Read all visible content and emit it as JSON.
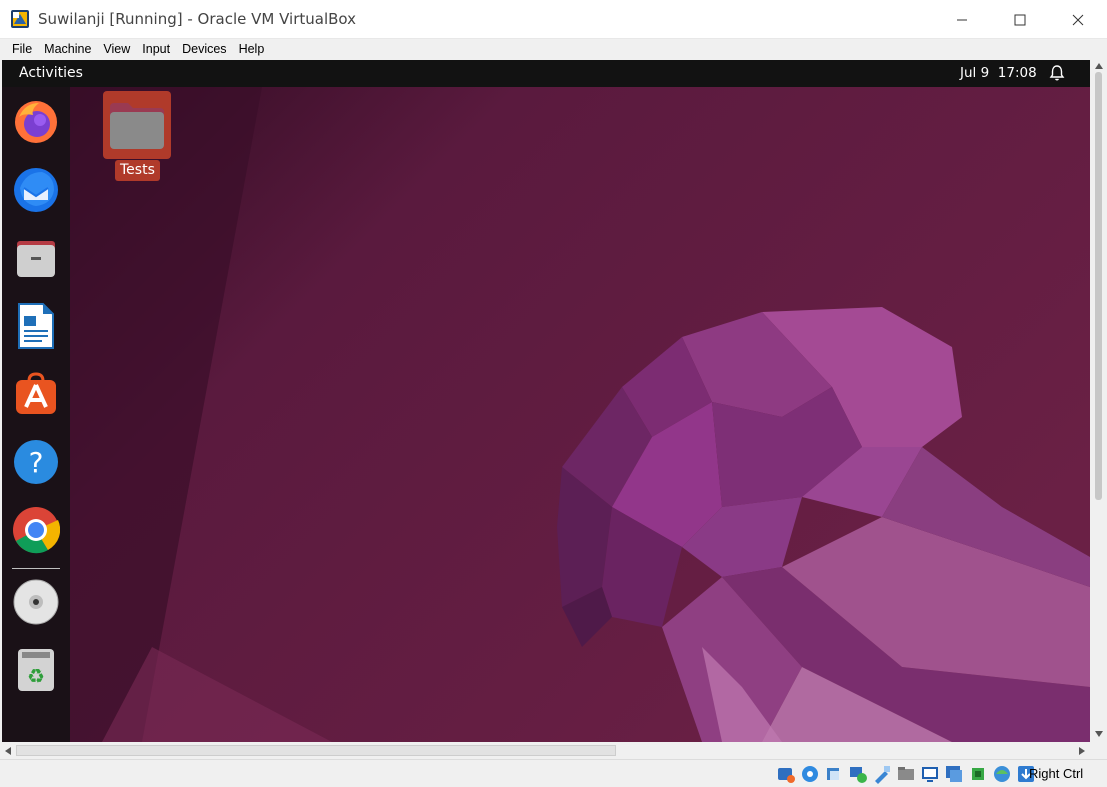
{
  "window": {
    "title": "Suwilanji [Running] - Oracle VM VirtualBox",
    "app_icon": "virtualbox-icon",
    "controls": [
      "minimize-icon",
      "maximize-icon",
      "close-icon"
    ]
  },
  "menubar": {
    "items": [
      "File",
      "Machine",
      "View",
      "Input",
      "Devices",
      "Help"
    ]
  },
  "guest": {
    "topbar": {
      "activities": "Activities",
      "date": "Jul 9",
      "time": "17:08",
      "notification_icon": "bell-icon"
    },
    "dock": {
      "items": [
        {
          "name": "firefox",
          "icon": "firefox-icon"
        },
        {
          "name": "thunderbird",
          "icon": "thunderbird-icon"
        },
        {
          "name": "files",
          "icon": "files-icon"
        },
        {
          "name": "libreoffice-writer",
          "icon": "writer-icon"
        },
        {
          "name": "app-center",
          "icon": "app-center-icon"
        },
        {
          "name": "help",
          "icon": "help-icon"
        },
        {
          "name": "chrome",
          "icon": "chrome-icon"
        },
        {
          "name": "disc",
          "icon": "disc-icon"
        },
        {
          "name": "trash",
          "icon": "trash-icon"
        }
      ]
    },
    "desktop": {
      "items": [
        {
          "label": "Tests",
          "icon": "folder-icon"
        }
      ]
    }
  },
  "statusbar": {
    "icons": [
      "hard-disk-icon",
      "optical-drive-icon",
      "audio-icon",
      "network-icon",
      "usb-icon",
      "shared-folders-icon",
      "display-icon",
      "recording-icon",
      "cpu-icon",
      "mouse-integration-icon",
      "keyboard-icon"
    ],
    "host_key": "Right Ctrl"
  },
  "colors": {
    "wallpaper_dark": "#2c0a1e",
    "wallpaper_mid": "#5e1a3d",
    "accent": "#e95420",
    "selection": "#b03a2a"
  }
}
